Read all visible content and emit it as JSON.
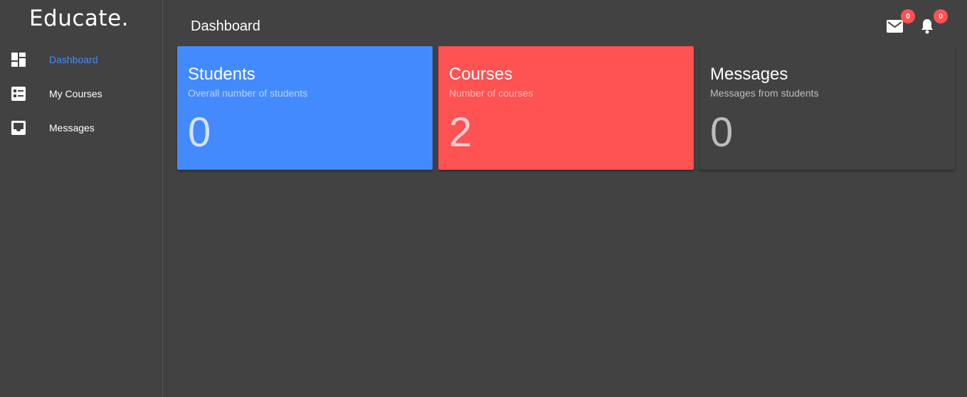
{
  "app": {
    "brand": "Educate."
  },
  "sidebar": {
    "items": [
      {
        "label": "Dashboard",
        "icon": "dashboard-icon",
        "active": true
      },
      {
        "label": "My Courses",
        "icon": "courses-list-icon",
        "active": false
      },
      {
        "label": "Messages",
        "icon": "inbox-icon",
        "active": false
      }
    ]
  },
  "header": {
    "title": "Dashboard",
    "mail": {
      "icon": "mail-icon",
      "count": "0"
    },
    "notifications": {
      "icon": "bell-icon",
      "count": "0"
    }
  },
  "cards": [
    {
      "title": "Students",
      "subtitle": "Overall number of students",
      "value": "0",
      "color": "#448aff"
    },
    {
      "title": "Courses",
      "subtitle": "Number of courses",
      "value": "2",
      "color": "#ff5252"
    },
    {
      "title": "Messages",
      "subtitle": "Messages from students",
      "value": "0",
      "color": "#424242"
    }
  ],
  "colors": {
    "background": "#424242",
    "accent": "#448aff",
    "badge": "#ff5252"
  }
}
